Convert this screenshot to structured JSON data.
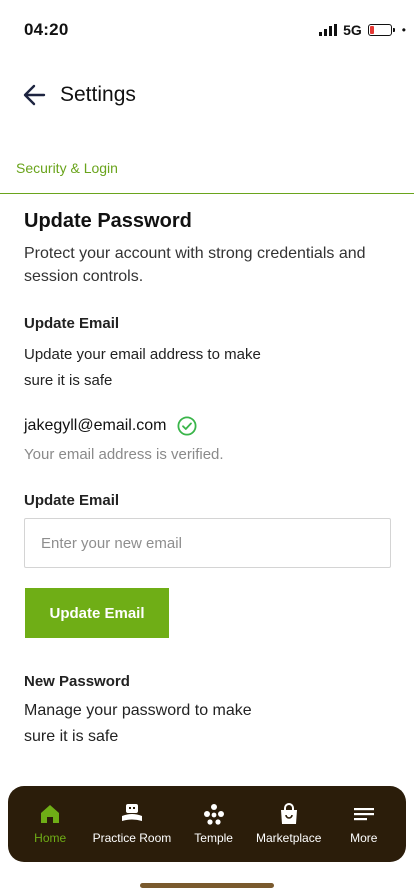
{
  "status_bar": {
    "time": "04:20",
    "network": "5G",
    "battery_level": 0.2,
    "battery_color": "#e53935"
  },
  "header": {
    "back_icon": "arrow-left-icon",
    "title": "Settings"
  },
  "section": {
    "label": "Security & Login",
    "accent_color": "#6aa41c"
  },
  "page": {
    "title": "Update Password",
    "subtitle": "Protect your account with strong credentials and session controls."
  },
  "email_section": {
    "heading": "Update Email",
    "description_line1": "Update your email address to make",
    "description_line2": "sure it is safe",
    "current_email": "jakegyll@email.com",
    "verified_icon": "check-circle-icon",
    "verified_text": "Your email address is verified.",
    "input_label": "Update Email",
    "input_placeholder": "Enter your new email",
    "input_value": "",
    "button_label": "Update Email",
    "button_color": "#6fae16"
  },
  "password_section": {
    "heading": "New Password",
    "description_line1": "Manage your password to make",
    "description_line2": "sure it is safe"
  },
  "bottom_nav": {
    "background": "#2b1d0a",
    "items": [
      {
        "label": "Home",
        "icon": "home-icon",
        "active": true
      },
      {
        "label": "Practice Room",
        "icon": "practice-room-icon",
        "active": false
      },
      {
        "label": "Temple",
        "icon": "temple-icon",
        "active": false
      },
      {
        "label": "Marketplace",
        "icon": "shopping-bag-icon",
        "active": false
      },
      {
        "label": "More",
        "icon": "menu-icon",
        "active": false
      }
    ]
  }
}
